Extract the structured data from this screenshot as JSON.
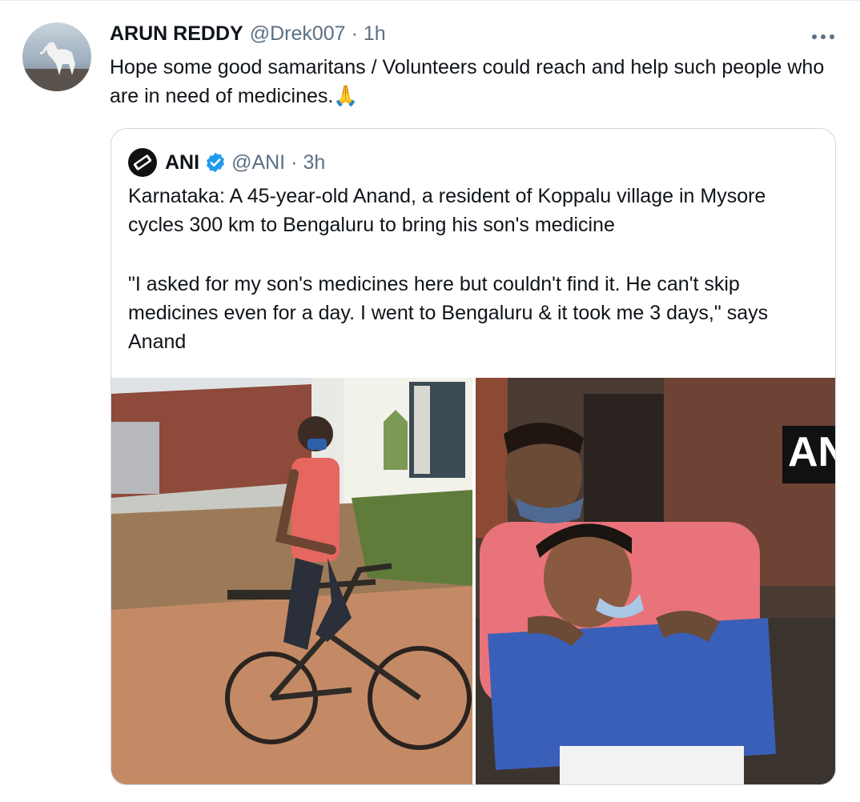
{
  "tweet": {
    "author_name": "ARUN REDDY",
    "author_handle": "@Drek007",
    "separator": "·",
    "time": "1h",
    "text": "Hope some good samaritans / Volunteers could reach and help such people who are in need of medicines.",
    "emoji": "🙏",
    "avatar_icon": "horse-avatar-icon",
    "more_icon": "more-options-icon"
  },
  "quoted_tweet": {
    "author_name": "ANI",
    "author_handle": "@ANI",
    "separator": "·",
    "time": "3h",
    "verified_icon": "verified-badge-icon",
    "paragraph_1": "Karnataka: A 45-year-old Anand, a resident of Koppalu village in Mysore cycles 300 km to Bengaluru to bring his son's medicine",
    "paragraph_2": "\"I asked for my son's medicines here but couldn't find it. He can't skip medicines even for a day. I went to Bengaluru & it took me 3 days,\" says Anand",
    "media_left": "man-on-bicycle-photo",
    "media_right": "father-and-son-photo",
    "media_right_watermark": "AN"
  },
  "colors": {
    "text": "#0f1419",
    "secondary": "#5b7083",
    "verified": "#1d9bf0",
    "border": "#cfd9de"
  }
}
